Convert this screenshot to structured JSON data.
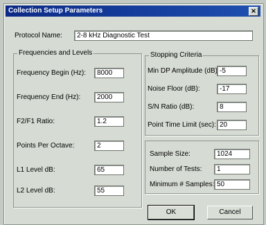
{
  "window": {
    "title": "Collection Setup Parameters",
    "close_glyph": "✕"
  },
  "protocol": {
    "label": "Protocol Name:",
    "value": "2-8 kHz Diagnostic Test"
  },
  "freq_group": {
    "title": "Frequencies and Levels",
    "fields": [
      {
        "label": "Frequency Begin (Hz):",
        "value": "8000"
      },
      {
        "label": "Frequency End (Hz):",
        "value": "2000"
      },
      {
        "label": "F2/F1 Ratio:",
        "value": "1.2"
      },
      {
        "label": "Points Per Octave:",
        "value": "2"
      },
      {
        "label": "L1 Level dB:",
        "value": "65"
      },
      {
        "label": "L2 Level dB:",
        "value": "55"
      }
    ]
  },
  "stop_group": {
    "title": "Stopping Criteria",
    "fields": [
      {
        "label": "Min DP Amplitude (dB):",
        "value": "-5"
      },
      {
        "label": "Noise Floor (dB):",
        "value": "-17"
      },
      {
        "label": "S/N Ratio (dB):",
        "value": "8"
      },
      {
        "label": "Point Time Limit (sec):",
        "value": "20"
      }
    ]
  },
  "sample_group": {
    "fields": [
      {
        "label": "Sample Size:",
        "value": "1024"
      },
      {
        "label": "Number of Tests:",
        "value": "1"
      },
      {
        "label": "Minimum # Samples:",
        "value": "50"
      }
    ]
  },
  "buttons": {
    "ok": "OK",
    "cancel": "Cancel"
  }
}
